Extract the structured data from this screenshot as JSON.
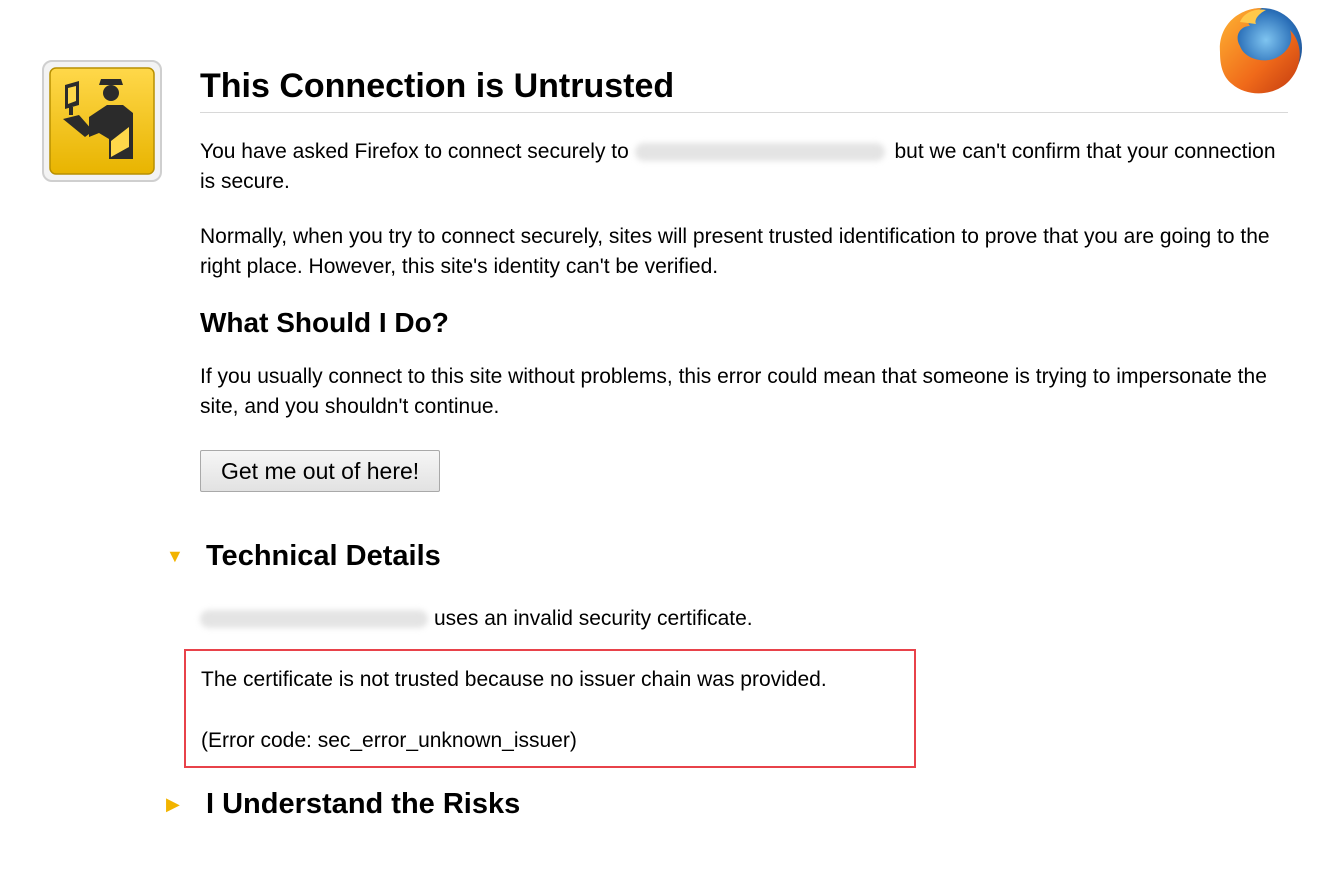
{
  "header": {
    "title": "This Connection is Untrusted",
    "icon": "identity-warning-icon",
    "logo": "firefox-logo-icon"
  },
  "intro": {
    "text_before": "You have asked Firefox to connect securely to",
    "text_after": "but we can't confirm that your connection is secure."
  },
  "explanation": "Normally, when you try to connect securely, sites will present trusted identification to prove that you are going to the right place. However, this site's identity can't be verified.",
  "what_to_do": {
    "heading": "What Should I Do?",
    "text": "If you usually connect to this site without problems, this error could mean that someone is trying to impersonate the site, and you shouldn't continue.",
    "button_label": "Get me out of here!"
  },
  "technical_details": {
    "heading": "Technical Details",
    "invalid_cert_text": "uses an invalid security certificate.",
    "trust_reason": "The certificate is not trusted because no issuer chain was provided.",
    "error_code": "(Error code: sec_error_unknown_issuer)",
    "arrow": "▼"
  },
  "risks": {
    "heading": "I Understand the Risks",
    "arrow": "▶"
  },
  "colors": {
    "accent_arrow": "#f2b400",
    "highlight_box": "#e8424a",
    "icon_yellow": "#f2c200"
  }
}
